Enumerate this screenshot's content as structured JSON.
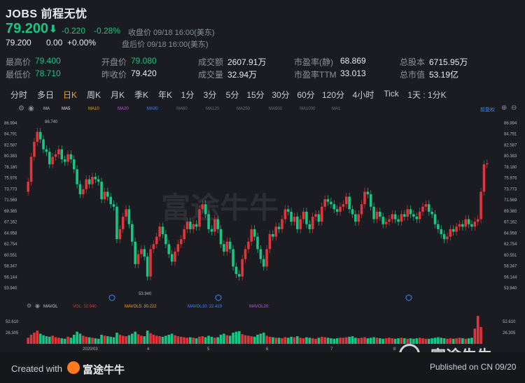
{
  "header": {
    "symbol": "JOBS",
    "name": "前程无忧",
    "price": "79.200",
    "arrow": "⬇",
    "change": "-0.220",
    "change_pct": "-0.28%",
    "close_label": "收盘价 09/18 16:00(美东)",
    "ah_price": "79.200",
    "ah_change": "0.00",
    "ah_pct": "+0.00%",
    "ah_label": "盘后价 09/18 16:00(美东)"
  },
  "stats": [
    {
      "label": "最高价",
      "value": "79.400"
    },
    {
      "label": "最低价",
      "value": "78.710"
    },
    {
      "label": "开盘价",
      "value": "79.080"
    },
    {
      "label": "昨收价",
      "value": "79.420"
    },
    {
      "label": "成交额",
      "value": "2607.91万"
    },
    {
      "label": "成交量",
      "value": "32.94万"
    },
    {
      "label": "市盈率(静)",
      "value": "68.869"
    },
    {
      "label": "市盈率TTM",
      "value": "33.013"
    },
    {
      "label": "总股本",
      "value": "6715.95万"
    },
    {
      "label": "总市值",
      "value": "53.19亿"
    }
  ],
  "tabs": [
    "分时",
    "多日",
    "日K",
    "周K",
    "月K",
    "季K",
    "年K",
    "1分",
    "3分",
    "5分",
    "15分",
    "30分",
    "60分",
    "120分",
    "4小时",
    "Tick",
    "1天 : 1分K"
  ],
  "active_tab": "日K",
  "ma_labels": [
    "MA",
    "MA5",
    "MA10",
    "MA20",
    "MA30",
    "MA60",
    "MA120",
    "MA250",
    "MA500",
    "MA1000",
    "MA1"
  ],
  "ma_right": "前复权",
  "price_axis": [
    "86.994",
    "84.791",
    "82.587",
    "80.383",
    "78.180",
    "75.976",
    "73.773",
    "71.569",
    "69.365",
    "67.162",
    "64.958",
    "62.754",
    "60.551",
    "58.347",
    "56.144",
    "53.940"
  ],
  "price_high_mark": "86.740",
  "price_low_mark": "53.940",
  "watermark": "富途牛牛",
  "volume": {
    "label": "MAVOL",
    "vol": "VOL: 32.940",
    "mavol5": "MAVOL5: 30.222",
    "mavol10": "MAVOL10: 22.419",
    "mavol20": "MAVOL20:",
    "axis": [
      "52.610",
      "26.305"
    ]
  },
  "x_axis": [
    "2020/03",
    "4",
    "5",
    "6",
    "7",
    "8"
  ],
  "footer": {
    "created": "Created with",
    "brand": "富途牛牛",
    "wm_brand": "富途牛牛",
    "published": "Published on CN 09/20"
  },
  "colors": {
    "up": "#e2353b",
    "down": "#16c784",
    "accent": "#f5a623"
  },
  "chart_data": {
    "type": "candlestick",
    "ylim": [
      53.94,
      86.994
    ],
    "closes": [
      75.5,
      80.5,
      83.5,
      85.5,
      84.0,
      82.0,
      81.5,
      79.0,
      80.5,
      81.0,
      82.0,
      80.0,
      79.5,
      81.0,
      80.0,
      78.0,
      75.0,
      73.0,
      74.0,
      76.0,
      75.0,
      76.5,
      76.0,
      75.5,
      72.0,
      73.5,
      72.5,
      71.0,
      70.5,
      64.0,
      66.0,
      68.5,
      70.0,
      67.0,
      63.5,
      59.0,
      61.0,
      62.0,
      60.5,
      56.5,
      62.0,
      63.0,
      64.5,
      66.5,
      65.0,
      63.0,
      61.0,
      59.5,
      61.5,
      63.0,
      64.0,
      66.0,
      67.5,
      66.0,
      67.0,
      66.5,
      70.0,
      71.0,
      69.0,
      66.0,
      65.5,
      68.0,
      66.0,
      63.0,
      61.5,
      63.5,
      62.0,
      58.5,
      57.0,
      56.5,
      60.0,
      62.0,
      63.5,
      66.0,
      64.5,
      62.0,
      60.0,
      58.5,
      62.0,
      65.0,
      64.5,
      66.5,
      66.0,
      68.0,
      70.0,
      69.5,
      67.5,
      68.5,
      66.0,
      68.0,
      69.5,
      67.0,
      66.0,
      68.5,
      69.0,
      67.5,
      70.5,
      72.0,
      71.5,
      71.0,
      70.0,
      69.5,
      70.5,
      71.0,
      72.5,
      70.0,
      69.0,
      67.5,
      69.0,
      71.0,
      73.5,
      73.0,
      70.5,
      68.0,
      69.5,
      68.5,
      67.0,
      67.5,
      68.0,
      69.0,
      68.0,
      67.5,
      69.0,
      68.5,
      70.0,
      69.0,
      68.5,
      68.0,
      69.5,
      70.5,
      71.0,
      69.5,
      69.0,
      67.0,
      66.0,
      65.0,
      64.0,
      64.5,
      66.0,
      65.5,
      66.5,
      67.0,
      66.5,
      68.0,
      67.0,
      66.5,
      67.5,
      68.0,
      73.5,
      79.0,
      79.2
    ],
    "volumes": [
      12,
      18,
      22,
      26,
      20,
      17,
      15,
      14,
      16,
      13,
      12,
      11,
      10,
      14,
      12,
      18,
      24,
      20,
      16,
      14,
      13,
      12,
      11,
      10,
      18,
      16,
      15,
      14,
      13,
      22,
      18,
      16,
      15,
      17,
      20,
      24,
      19,
      16,
      15,
      26,
      21,
      18,
      16,
      15,
      14,
      16,
      18,
      20,
      17,
      15,
      14,
      13,
      12,
      13,
      12,
      11,
      14,
      15,
      13,
      16,
      14,
      12,
      13,
      18,
      20,
      17,
      16,
      22,
      24,
      25,
      19,
      17,
      16,
      15,
      14,
      18,
      20,
      22,
      16,
      14,
      13,
      12,
      12,
      11,
      13,
      12,
      14,
      13,
      15,
      12,
      11,
      13,
      12,
      11,
      10,
      12,
      14,
      13,
      12,
      11,
      10,
      11,
      12,
      12,
      13,
      14,
      15,
      12,
      11,
      12,
      13,
      11,
      12,
      13,
      12,
      11,
      10,
      11,
      12,
      11,
      10,
      11,
      12,
      11,
      10,
      11,
      10,
      11,
      12,
      11,
      10,
      10,
      11,
      12,
      13,
      12,
      11,
      10,
      11,
      10,
      11,
      12,
      11,
      10,
      11,
      12,
      30,
      55,
      33
    ]
  }
}
